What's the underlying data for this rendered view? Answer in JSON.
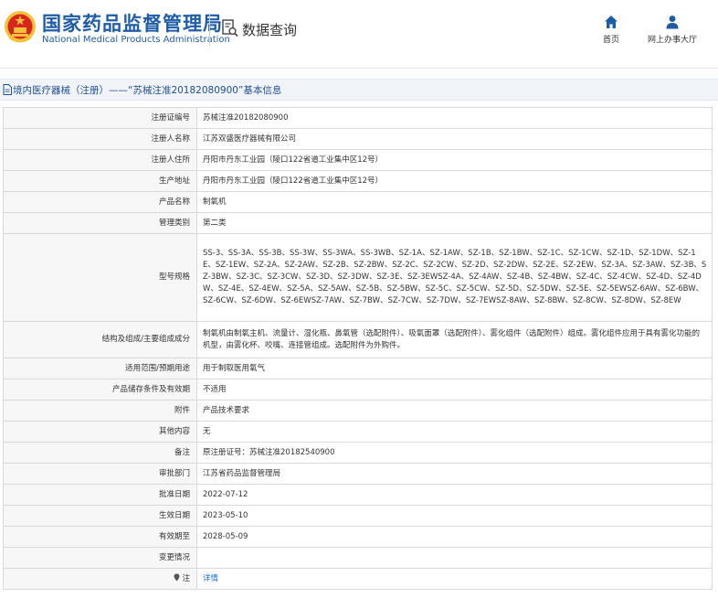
{
  "header": {
    "brand_cn": "国家药品监督管理局",
    "brand_en": "National Medical Products Administration",
    "query_label": "数据查询",
    "nav": [
      {
        "label": "首页",
        "icon": "home-icon"
      },
      {
        "label": "网上办事大厅",
        "icon": "user-icon"
      }
    ],
    "colors": {
      "brand": "#1f5ca8",
      "logo_red": "#d7261d",
      "logo_gold": "#f3c13a"
    }
  },
  "title_bar": {
    "text": "境内医疗器械（注册）——“苏械注准20182080900”基本信息",
    "icon": "document-icon"
  },
  "rows": [
    {
      "key": "注册证编号",
      "value": "苏械注准20182080900"
    },
    {
      "key": "注册人名称",
      "value": "江苏双盛医疗器械有限公司"
    },
    {
      "key": "注册人住所",
      "value": "丹阳市丹东工业园（陵口122省道工业集中区12号）"
    },
    {
      "key": "生产地址",
      "value": "丹阳市丹东工业园（陵口122省道工业集中区12号）"
    },
    {
      "key": "产品名称",
      "value": "制氧机"
    },
    {
      "key": "管理类别",
      "value": "第二类"
    },
    {
      "key": "型号规格",
      "value": "SS-3、SS-3A、SS-3B、SS-3W、SS-3WA、SS-3WB、SZ-1A、SZ-1AW、SZ-1B、SZ-1BW、SZ-1C、SZ-1CW、SZ-1D、SZ-1DW、SZ-1E、SZ-1EW、SZ-2A、SZ-2AW、SZ-2B、SZ-2BW、SZ-2C、SZ-2CW、SZ-2D、SZ-2DW、SZ-2E、SZ-2EW、SZ-3A、SZ-3AW、SZ-3B、SZ-3BW、SZ-3C、SZ-3CW、SZ-3D、SZ-3DW、SZ-3E、SZ-3EWSZ-4A、SZ-4AW、SZ-4B、SZ-4BW、SZ-4C、SZ-4CW、SZ-4D、SZ-4DW、SZ-4E、SZ-4EW、SZ-5A、SZ-5AW、SZ-5B、SZ-5BW、SZ-5C、SZ-5CW、SZ-5D、SZ-5DW、SZ-5E、SZ-5EWSZ-6AW、SZ-6BW、SZ-6CW、SZ-6DW、SZ-6EWSZ-7AW、SZ-7BW、SZ-7CW、SZ-7DW、SZ-7EWSZ-8AW、SZ-8BW、SZ-8CW、SZ-8DW、SZ-8EW"
    },
    {
      "key": "结构及组成/主要组成成分",
      "value": "制氧机由制氧主机、流量计、湿化瓶、鼻氧管（选配附件）、吸氧面罩（选配附件）、雾化组件（选配附件）组成。雾化组件应用于具有雾化功能的机型，由雾化杯、咬嘴、连接管组成。选配附件为外购件。"
    },
    {
      "key": "适用范围/预期用途",
      "value": "用于制取医用氧气"
    },
    {
      "key": "产品储存条件及有效期",
      "value": "不适用"
    },
    {
      "key": "附件",
      "value": "产品技术要求"
    },
    {
      "key": "其他内容",
      "value": "无"
    },
    {
      "key": "备注",
      "value": "原注册证号：苏械注准20182540900"
    },
    {
      "key": "审批部门",
      "value": "江苏省药品监督管理局"
    },
    {
      "key": "批准日期",
      "value": "2022-07-12"
    },
    {
      "key": "生效日期",
      "value": "2023-05-10"
    },
    {
      "key": "有效期至",
      "value": "2028-05-09"
    },
    {
      "key": "变更情况",
      "value": ""
    },
    {
      "key": "注",
      "value": "详情",
      "link": true,
      "key_icon": "note-icon"
    }
  ]
}
